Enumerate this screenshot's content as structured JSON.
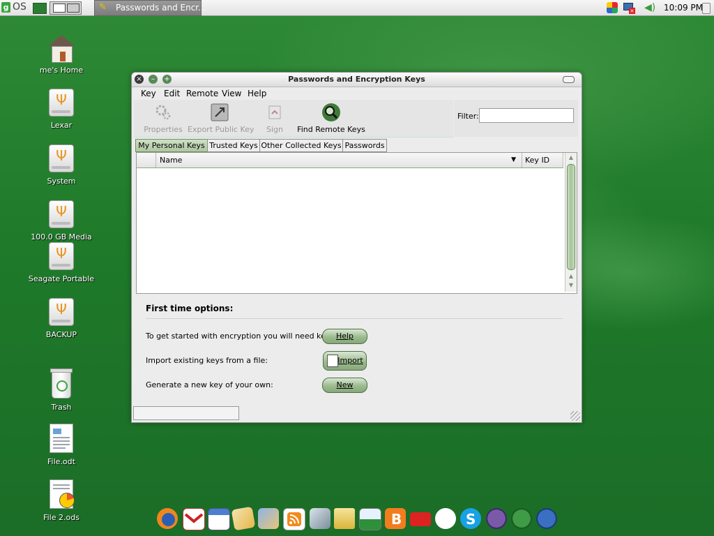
{
  "top_panel": {
    "menu_logo": "g",
    "os_label": "OS",
    "taskbar_window": "Passwords and Encr...",
    "clock": "10:09 PM"
  },
  "desktop_icons": [
    {
      "label": "me's Home",
      "icon": "home-folder-icon"
    },
    {
      "label": "Lexar",
      "icon": "usb-drive-icon"
    },
    {
      "label": "System",
      "icon": "usb-drive-icon"
    },
    {
      "label": "100.0 GB Media",
      "icon": "usb-drive-icon"
    },
    {
      "label": "Seagate Portable",
      "icon": "usb-drive-icon"
    },
    {
      "label": "BACKUP",
      "icon": "usb-drive-icon"
    },
    {
      "label": "Trash",
      "icon": "trash-icon"
    },
    {
      "label": "File.odt",
      "icon": "text-document-icon"
    },
    {
      "label": "File 2.ods",
      "icon": "spreadsheet-icon"
    }
  ],
  "window": {
    "title": "Passwords and Encryption Keys",
    "menu": [
      "Key",
      "Edit",
      "Remote",
      "View",
      "Help"
    ],
    "toolbar": [
      {
        "label": "Properties",
        "icon": "gears-icon",
        "enabled": false
      },
      {
        "label": "Export Public Key",
        "icon": "export-icon",
        "enabled": false
      },
      {
        "label": "Sign",
        "icon": "sign-icon",
        "enabled": false
      },
      {
        "label": "Find Remote Keys",
        "icon": "search-icon",
        "enabled": true
      }
    ],
    "filter_label": "Filter:",
    "filter_value": "",
    "tabs": [
      "My Personal Keys",
      "Trusted Keys",
      "Other Collected Keys",
      "Passwords"
    ],
    "active_tab": "My Personal Keys",
    "columns": [
      "Name",
      "Key ID"
    ],
    "rows": [],
    "first_time": {
      "title": "First time options:",
      "options": [
        {
          "text": "To get started with encryption you will need keys.",
          "button": "Help"
        },
        {
          "text": "Import existing keys from a file:",
          "button": "Import"
        },
        {
          "text": "Generate a new key of your own:",
          "button": "New"
        }
      ]
    }
  },
  "dock": [
    "firefox-icon",
    "gmail-icon",
    "calendar-icon",
    "paint-icon",
    "photo-icon",
    "rss-icon",
    "news-icon",
    "shopping-bag-icon",
    "image-viewer-icon",
    "blogger-icon",
    "youtube-icon",
    "chat-icon",
    "skype-icon",
    "openoffice-writer-icon",
    "openoffice-calc-icon",
    "openoffice-impress-icon"
  ]
}
